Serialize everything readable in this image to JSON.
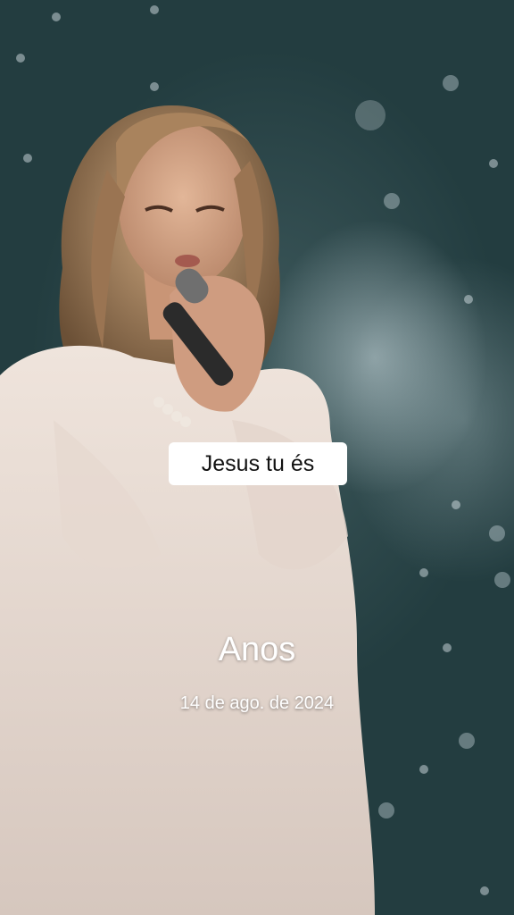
{
  "video": {
    "caption": "Jesus tu és",
    "title": "Anos",
    "date": "14 de ago. de 2024"
  },
  "colors": {
    "background": "#2b4649",
    "caption_box": "#ffffff",
    "caption_text": "#111111",
    "overlay_text": "#ffffff"
  }
}
